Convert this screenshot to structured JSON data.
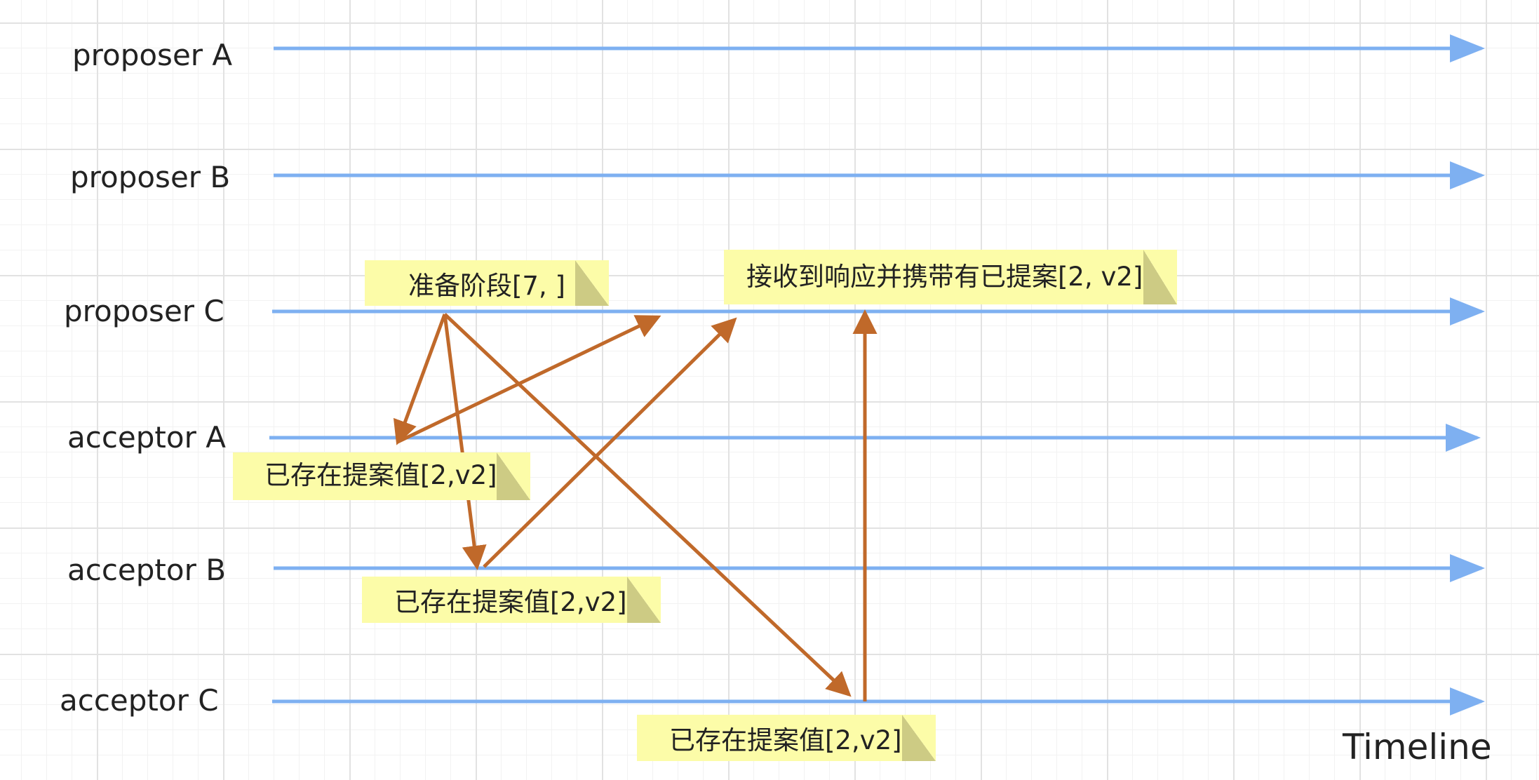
{
  "lanes": [
    {
      "label": "proposer A"
    },
    {
      "label": "proposer B"
    },
    {
      "label": "proposer C"
    },
    {
      "label": "acceptor A"
    },
    {
      "label": "acceptor B"
    },
    {
      "label": "acceptor C"
    }
  ],
  "notes": {
    "prepare": "准备阶段[7, ]",
    "response": "接收到响应并携带有已提案[2, v2]",
    "acceptor_a": "已存在提案值[2,v2]",
    "acceptor_b": "已存在提案值[2,v2]",
    "acceptor_c": "已存在提案值[2,v2]"
  },
  "timeline_label": "Timeline",
  "colors": {
    "lane": "#7eb0f1",
    "message": "#c0692a",
    "note": "#fcfca8",
    "note_fold": "#cdcb84"
  }
}
